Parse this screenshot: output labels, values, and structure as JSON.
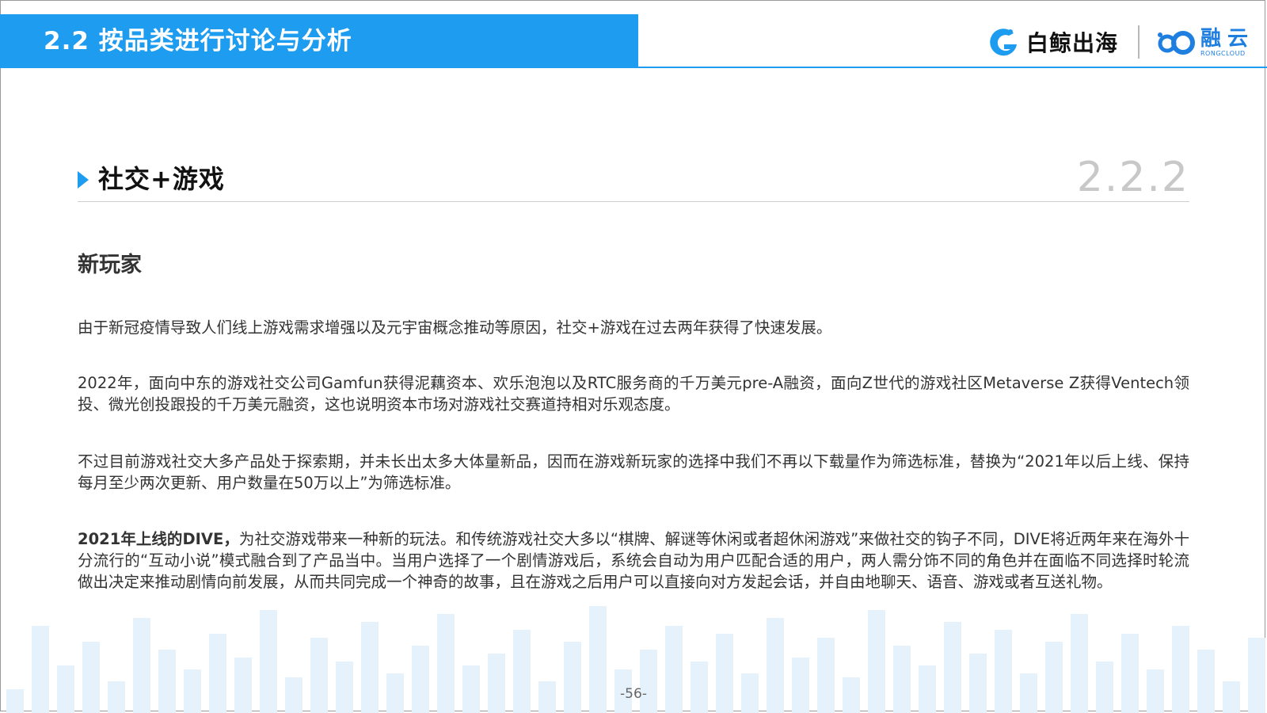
{
  "header": {
    "title": "2.2 按品类进行讨论与分析",
    "logo_a_text": "白鲸出海",
    "logo_b_cn": "融云",
    "logo_b_en": "RONGCLOUD"
  },
  "section": {
    "heading": "社交+游戏",
    "number": "2.2.2"
  },
  "content": {
    "subheading": "新玩家",
    "p1": "由于新冠疫情导致人们线上游戏需求增强以及元宇宙概念推动等原因，社交+游戏在过去两年获得了快速发展。",
    "p2": "2022年，面向中东的游戏社交公司Gamfun获得泥藕资本、欢乐泡泡以及RTC服务商的千万美元pre-A融资，面向Z世代的游戏社区Metaverse Z获得Ventech领投、微光创投跟投的千万美元融资，这也说明资本市场对游戏社交赛道持相对乐观态度。",
    "p3": "不过目前游戏社交大多产品处于探索期，并未长出太多大体量新品，因而在游戏新玩家的选择中我们不再以下载量作为筛选标准，替换为“2021年以后上线、保持每月至少两次更新、用户数量在50万以上”为筛选标准。",
    "p4_bold": "2021年上线的DIVE，",
    "p4_rest": "为社交游戏带来一种新的玩法。和传统游戏社交大多以“棋牌、解谜等休闲或者超休闲游戏”来做社交的钩子不同，DIVE将近两年来在海外十分流行的“互动小说”模式融合到了产品当中。当用户选择了一个剧情游戏后，系统会自动为用户匹配合适的用户，两人需分饰不同的角色并在面临不同选择时轮流做出决定来推动剧情向前发展，从而共同完成一个神奇的故事，且在游戏之后用户可以直接向对方发起会话，并自由地聊天、语音、游戏或者互送礼物。"
  },
  "footer": {
    "page_number": "-56-"
  },
  "colors": {
    "accent": "#1e9cf0",
    "bars": "#e6f2fb"
  }
}
